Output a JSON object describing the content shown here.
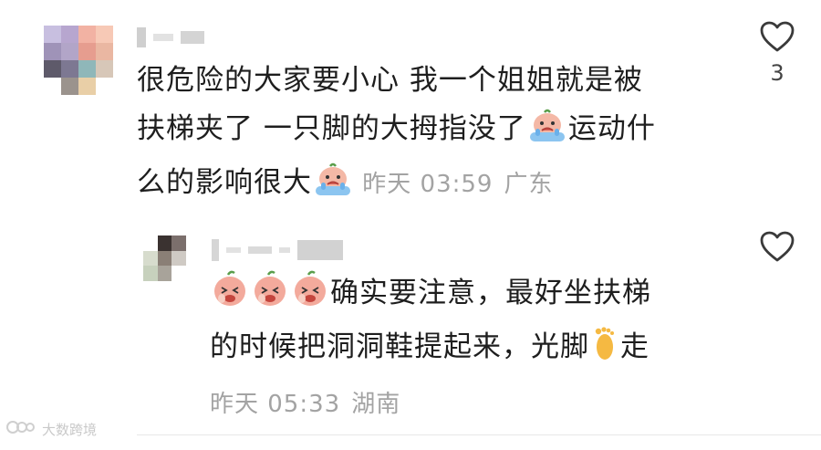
{
  "comments": [
    {
      "text_line1": "很危险的大家要小心 我一个姐姐就是被",
      "text_line2a": "扶梯夹了 一只脚的大拇指没了",
      "text_line2b": "运动什",
      "text_line3": "么的影响很大",
      "emoji_1": "crying-face-emoji",
      "emoji_2": "crying-face-emoji",
      "time": "昨天 03:59",
      "location": "广东",
      "like_count": "3",
      "like_icon": "heart-outline-icon"
    },
    {
      "emojis": [
        "peach-laugh-emoji",
        "peach-laugh-emoji",
        "peach-laugh-emoji"
      ],
      "text_line1": "确实要注意，最好坐扶梯",
      "text_line2a": "的时候把洞洞鞋提起来，光脚",
      "text_line2b": "走",
      "foot_emoji": "foot-emoji",
      "time": "昨天 05:33",
      "location": "湖南",
      "like_icon": "heart-outline-icon"
    }
  ],
  "watermark": {
    "text": "大数跨境"
  },
  "colors": {
    "text": "#1e1e1e",
    "meta": "#a3a3a3",
    "icon": "#3a3a3a",
    "blur_name": "#d9d9d9"
  }
}
